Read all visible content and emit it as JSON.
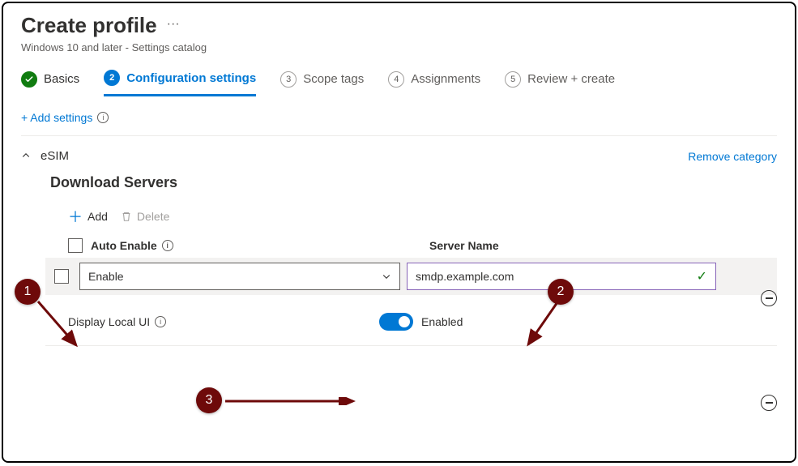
{
  "header": {
    "title": "Create profile",
    "subtitle": "Windows 10 and later - Settings catalog"
  },
  "tabs": {
    "basics": "Basics",
    "config": "Configuration settings",
    "scope": "Scope tags",
    "assignments": "Assignments",
    "review": "Review + create",
    "num2": "2",
    "num3": "3",
    "num4": "4",
    "num5": "5"
  },
  "links": {
    "add_settings": "+ Add settings",
    "remove_category": "Remove category"
  },
  "category": {
    "name": "eSIM"
  },
  "section": {
    "title": "Download Servers"
  },
  "actions": {
    "add": "Add",
    "delete": "Delete"
  },
  "columns": {
    "auto_enable": "Auto Enable",
    "server_name": "Server Name"
  },
  "row": {
    "auto_enable_value": "Enable",
    "server_name_value": "smdp.example.com"
  },
  "display_local_ui": {
    "label": "Display Local UI",
    "value_label": "Enabled"
  },
  "callouts": {
    "c1": "1",
    "c2": "2",
    "c3": "3"
  }
}
